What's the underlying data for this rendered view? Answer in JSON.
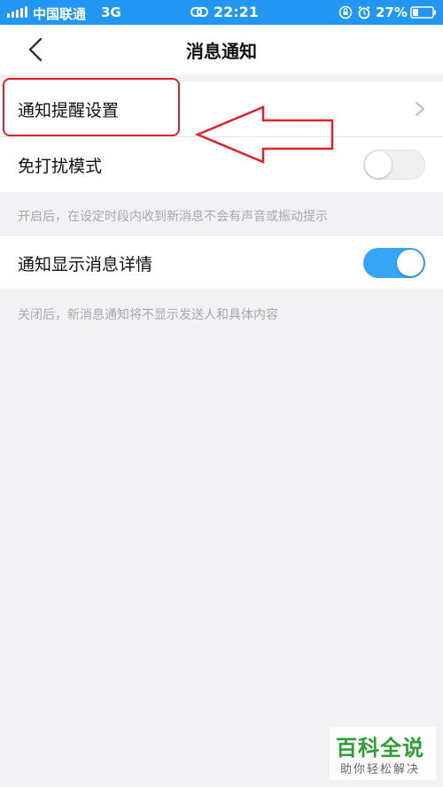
{
  "status_bar": {
    "carrier": "中国联通",
    "network": "3G",
    "time": "22:21",
    "battery_percent": "27%"
  },
  "nav": {
    "title": "消息通知"
  },
  "settings": {
    "notify_reminder": {
      "label": "通知提醒设置"
    },
    "dnd_mode": {
      "label": "免打扰模式",
      "enabled": false,
      "hint": "开启后，在设定时段内收到新消息不会有声音或振动提示"
    },
    "show_details": {
      "label": "通知显示消息详情",
      "enabled": true,
      "hint": "关闭后，新消息通知将不显示发送人和具体内容"
    }
  },
  "watermark": {
    "title": "百科全说",
    "subtitle": "助你轻松解决"
  },
  "colors": {
    "status_bar": "#2196f3",
    "toggle_on": "#35a5f5",
    "annotation_red": "#e0202a",
    "watermark_green": "#2e9d32"
  }
}
